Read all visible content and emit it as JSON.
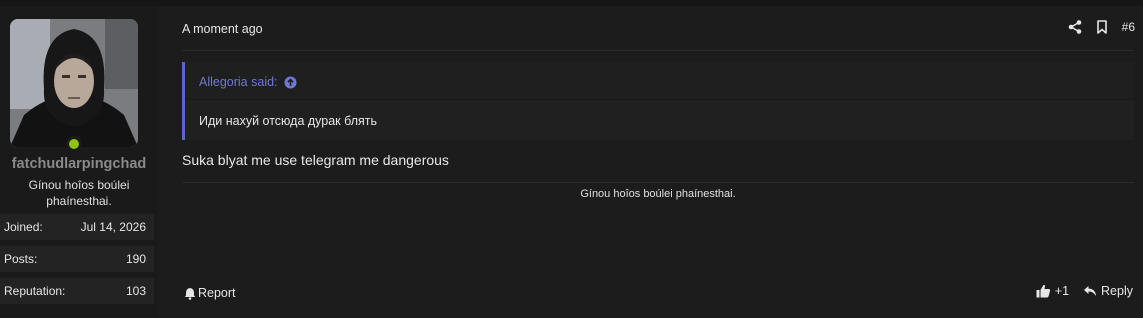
{
  "author": {
    "username": "fatchudlarpingchad",
    "title": "Gínou hoîos boúlei phaínesthai.",
    "online_color": "#8fc40a",
    "stats": [
      {
        "label": "Joined:",
        "value": "Jul 14, 2026"
      },
      {
        "label": "Posts:",
        "value": "190"
      },
      {
        "label": "Reputation:",
        "value": "103"
      }
    ]
  },
  "post": {
    "time": "A moment ago",
    "number": "#6",
    "quote": {
      "author": "Allegoria said:",
      "text": "Иди нахуй отсюда дурак блять"
    },
    "message": "Suka blyat me use telegram me dangerous",
    "signature": "Gínou hoîos boúlei phaínesthai.",
    "report_label": "Report",
    "reaction_count": "+1",
    "reply_label": "Reply"
  },
  "icons": [
    "share-icon",
    "bookmark-icon",
    "arrow-up-circle-icon",
    "bell-icon",
    "thumbs-up-icon",
    "reply-icon"
  ],
  "accent_color": "#5b66c9"
}
